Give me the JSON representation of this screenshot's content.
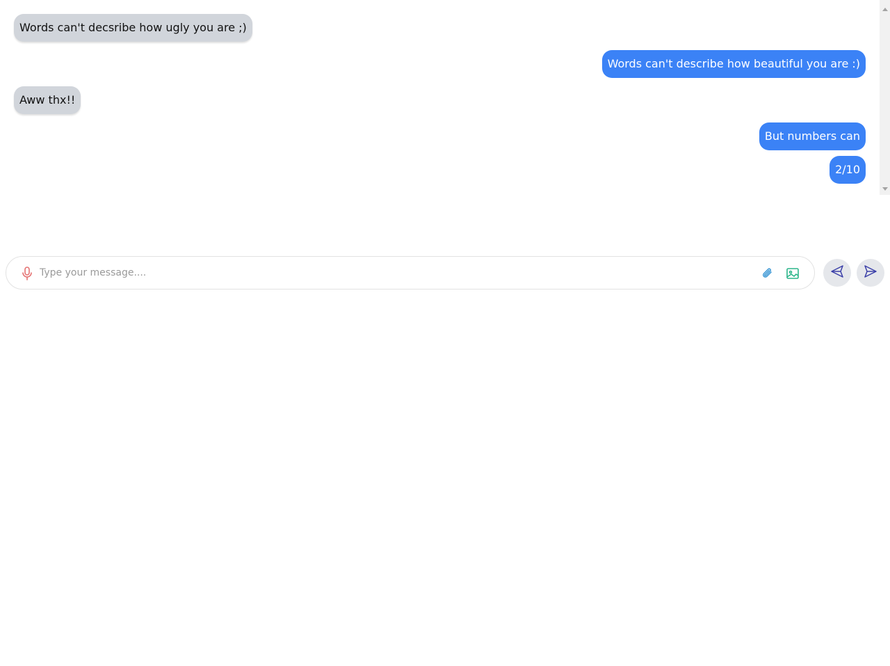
{
  "colors": {
    "incoming_bubble": "#d1d5db",
    "outgoing_bubble": "#3b82f6",
    "mic_icon": "#e57373",
    "attach_icon": "#4a9fd8",
    "image_icon": "#2bb58a",
    "send_icon": "#3b3fa8"
  },
  "messages": [
    {
      "direction": "in",
      "text": "Words can't decsribe how ugly you are ;)"
    },
    {
      "direction": "out",
      "text": "Words can't describe how beautiful you are :)"
    },
    {
      "direction": "in",
      "text": "Aww thx!!"
    },
    {
      "direction": "out",
      "text": "But numbers can"
    },
    {
      "direction": "out",
      "text": "2/10"
    }
  ],
  "composer": {
    "placeholder": "Type your message....",
    "value": "",
    "icons": {
      "mic": "microphone-icon",
      "attach": "paperclip-icon",
      "image": "image-icon",
      "back": "send-left-icon",
      "send": "send-icon"
    }
  }
}
